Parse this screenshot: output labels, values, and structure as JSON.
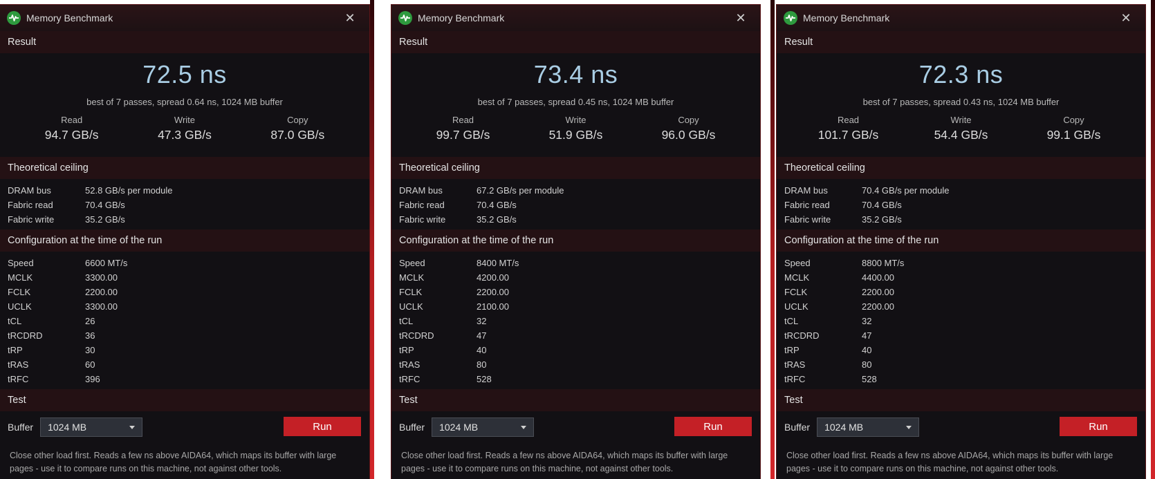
{
  "windows": [
    {
      "title": "Memory Benchmark",
      "result_header": "Result",
      "latency": "72.5 ns",
      "summary": "best of 7 passes, spread 0.64 ns, 1024 MB buffer",
      "read_label": "Read",
      "read_value": "94.7 GB/s",
      "write_label": "Write",
      "write_value": "47.3 GB/s",
      "copy_label": "Copy",
      "copy_value": "87.0 GB/s",
      "ceiling_header": "Theoretical ceiling",
      "ceiling": [
        {
          "k": "DRAM bus",
          "v": "52.8 GB/s per module"
        },
        {
          "k": "Fabric read",
          "v": "70.4 GB/s"
        },
        {
          "k": "Fabric write",
          "v": "35.2 GB/s"
        }
      ],
      "config_header": "Configuration at the time of the run",
      "config": [
        {
          "k": "Speed",
          "v": "6600 MT/s"
        },
        {
          "k": "MCLK",
          "v": "3300.00"
        },
        {
          "k": "FCLK",
          "v": "2200.00"
        },
        {
          "k": "UCLK",
          "v": "3300.00"
        },
        {
          "k": "tCL",
          "v": "26"
        },
        {
          "k": "tRCDRD",
          "v": "36"
        },
        {
          "k": "tRP",
          "v": "30"
        },
        {
          "k": "tRAS",
          "v": "60"
        },
        {
          "k": "tRFC",
          "v": "396"
        }
      ],
      "test_header": "Test",
      "buffer_label": "Buffer",
      "buffer_value": "1024 MB",
      "run_label": "Run",
      "note": "Close other load first. Reads a few ns above AIDA64, which maps its buffer with large pages - use it to compare runs on this machine, not against other tools."
    },
    {
      "title": "Memory Benchmark",
      "result_header": "Result",
      "latency": "73.4 ns",
      "summary": "best of 7 passes, spread 0.45 ns, 1024 MB buffer",
      "read_label": "Read",
      "read_value": "99.7 GB/s",
      "write_label": "Write",
      "write_value": "51.9 GB/s",
      "copy_label": "Copy",
      "copy_value": "96.0 GB/s",
      "ceiling_header": "Theoretical ceiling",
      "ceiling": [
        {
          "k": "DRAM bus",
          "v": "67.2 GB/s per module"
        },
        {
          "k": "Fabric read",
          "v": "70.4 GB/s"
        },
        {
          "k": "Fabric write",
          "v": "35.2 GB/s"
        }
      ],
      "config_header": "Configuration at the time of the run",
      "config": [
        {
          "k": "Speed",
          "v": "8400 MT/s"
        },
        {
          "k": "MCLK",
          "v": "4200.00"
        },
        {
          "k": "FCLK",
          "v": "2200.00"
        },
        {
          "k": "UCLK",
          "v": "2100.00"
        },
        {
          "k": "tCL",
          "v": "32"
        },
        {
          "k": "tRCDRD",
          "v": "47"
        },
        {
          "k": "tRP",
          "v": "40"
        },
        {
          "k": "tRAS",
          "v": "80"
        },
        {
          "k": "tRFC",
          "v": "528"
        }
      ],
      "test_header": "Test",
      "buffer_label": "Buffer",
      "buffer_value": "1024 MB",
      "run_label": "Run",
      "note": "Close other load first. Reads a few ns above AIDA64, which maps its buffer with large pages - use it to compare runs on this machine, not against other tools."
    },
    {
      "title": "Memory Benchmark",
      "result_header": "Result",
      "latency": "72.3 ns",
      "summary": "best of 7 passes, spread 0.43 ns, 1024 MB buffer",
      "read_label": "Read",
      "read_value": "101.7 GB/s",
      "write_label": "Write",
      "write_value": "54.4 GB/s",
      "copy_label": "Copy",
      "copy_value": "99.1 GB/s",
      "ceiling_header": "Theoretical ceiling",
      "ceiling": [
        {
          "k": "DRAM bus",
          "v": "70.4 GB/s per module"
        },
        {
          "k": "Fabric read",
          "v": "70.4 GB/s"
        },
        {
          "k": "Fabric write",
          "v": "35.2 GB/s"
        }
      ],
      "config_header": "Configuration at the time of the run",
      "config": [
        {
          "k": "Speed",
          "v": "8800 MT/s"
        },
        {
          "k": "MCLK",
          "v": "4400.00"
        },
        {
          "k": "FCLK",
          "v": "2200.00"
        },
        {
          "k": "UCLK",
          "v": "2200.00"
        },
        {
          "k": "tCL",
          "v": "32"
        },
        {
          "k": "tRCDRD",
          "v": "47"
        },
        {
          "k": "tRP",
          "v": "40"
        },
        {
          "k": "tRAS",
          "v": "80"
        },
        {
          "k": "tRFC",
          "v": "528"
        }
      ],
      "test_header": "Test",
      "buffer_label": "Buffer",
      "buffer_value": "1024 MB",
      "run_label": "Run",
      "note": "Close other load first. Reads a few ns above AIDA64, which maps its buffer with large pages - use it to compare runs on this machine, not against other tools."
    }
  ]
}
